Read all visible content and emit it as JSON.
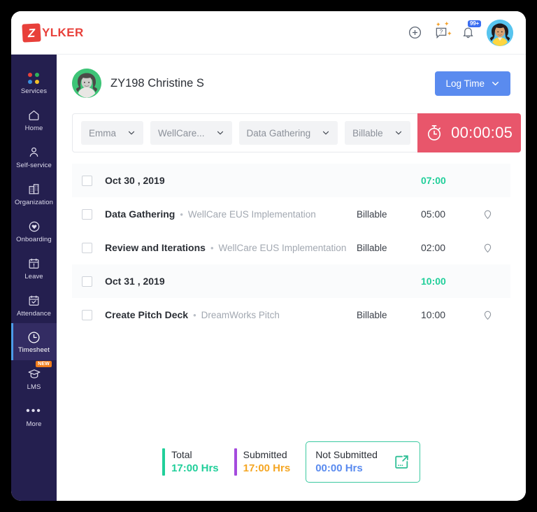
{
  "brand": {
    "mark": "Z",
    "name": "YLKER",
    "color": "#e8403a"
  },
  "topbar": {
    "icons": [
      {
        "name": "add-icon",
        "glyph": "plus-circle"
      },
      {
        "name": "help-icon",
        "glyph": "question-bubble"
      },
      {
        "name": "notifications-icon",
        "glyph": "bell",
        "badge": "99+"
      }
    ],
    "avatar_alt": "User profile"
  },
  "sidebar": {
    "items": [
      {
        "label": "Services",
        "icon": "color-dots-icon",
        "active": false
      },
      {
        "label": "Home",
        "icon": "home-icon",
        "active": false
      },
      {
        "label": "Self-service",
        "icon": "person-icon",
        "active": false
      },
      {
        "label": "Organization",
        "icon": "building-icon",
        "active": false
      },
      {
        "label": "Onboarding",
        "icon": "handshake-heart-icon",
        "active": false
      },
      {
        "label": "Leave",
        "icon": "calendar-alert-icon",
        "active": false
      },
      {
        "label": "Attendance",
        "icon": "calendar-check-icon",
        "active": false
      },
      {
        "label": "Timesheet",
        "icon": "clock-icon",
        "active": true
      },
      {
        "label": "LMS",
        "icon": "graduation-cap-icon",
        "active": false,
        "badge": "NEW"
      },
      {
        "label": "More",
        "icon": "ellipsis-icon",
        "active": false
      }
    ],
    "badge_color": "#f07c1b",
    "active_accent": "#4c9ae8"
  },
  "page": {
    "user_id_name": "ZY198 Christine S",
    "log_time_label": "Log Time"
  },
  "filters": [
    {
      "name": "user-filter",
      "value": "Emma"
    },
    {
      "name": "project-filter",
      "value": "WellCare..."
    },
    {
      "name": "job-filter",
      "value": "Data Gathering"
    },
    {
      "name": "billable-filter",
      "value": "Billable"
    }
  ],
  "timer": {
    "value": "00:00:05",
    "icon": "stopwatch-icon",
    "color": "#e8566b"
  },
  "timesheet": {
    "groups": [
      {
        "date": "Oct 30 , 2019",
        "total": "07:00",
        "entries": [
          {
            "task": "Data Gathering",
            "project": "WellCare EUS Implementation",
            "billable": "Billable",
            "hours": "05:00",
            "pin": "location-pin-icon"
          },
          {
            "task": "Review and Iterations",
            "project": "WellCare EUS Implementation",
            "billable": "Billable",
            "hours": "02:00",
            "pin": "location-pin-icon"
          }
        ]
      },
      {
        "date": "Oct 31 , 2019",
        "total": "10:00",
        "entries": [
          {
            "task": "Create Pitch Deck",
            "project": "DreamWorks Pitch",
            "billable": "Billable",
            "hours": "10:00",
            "pin": "location-pin-icon"
          }
        ]
      }
    ],
    "separator": "•",
    "total_color": "#21cf9a"
  },
  "summary": {
    "total": {
      "title": "Total",
      "value": "17:00 Hrs",
      "bar_color": "#21cf9a",
      "value_color": "#21cf9a"
    },
    "submitted": {
      "title": "Submitted",
      "value": "17:00 Hrs",
      "bar_color": "#a44bdd",
      "value_color": "#f5a623"
    },
    "not_submitted": {
      "title": "Not Submitted",
      "value": "00:00 Hrs",
      "value_color": "#5a8bef",
      "icon": "export-icon"
    }
  }
}
